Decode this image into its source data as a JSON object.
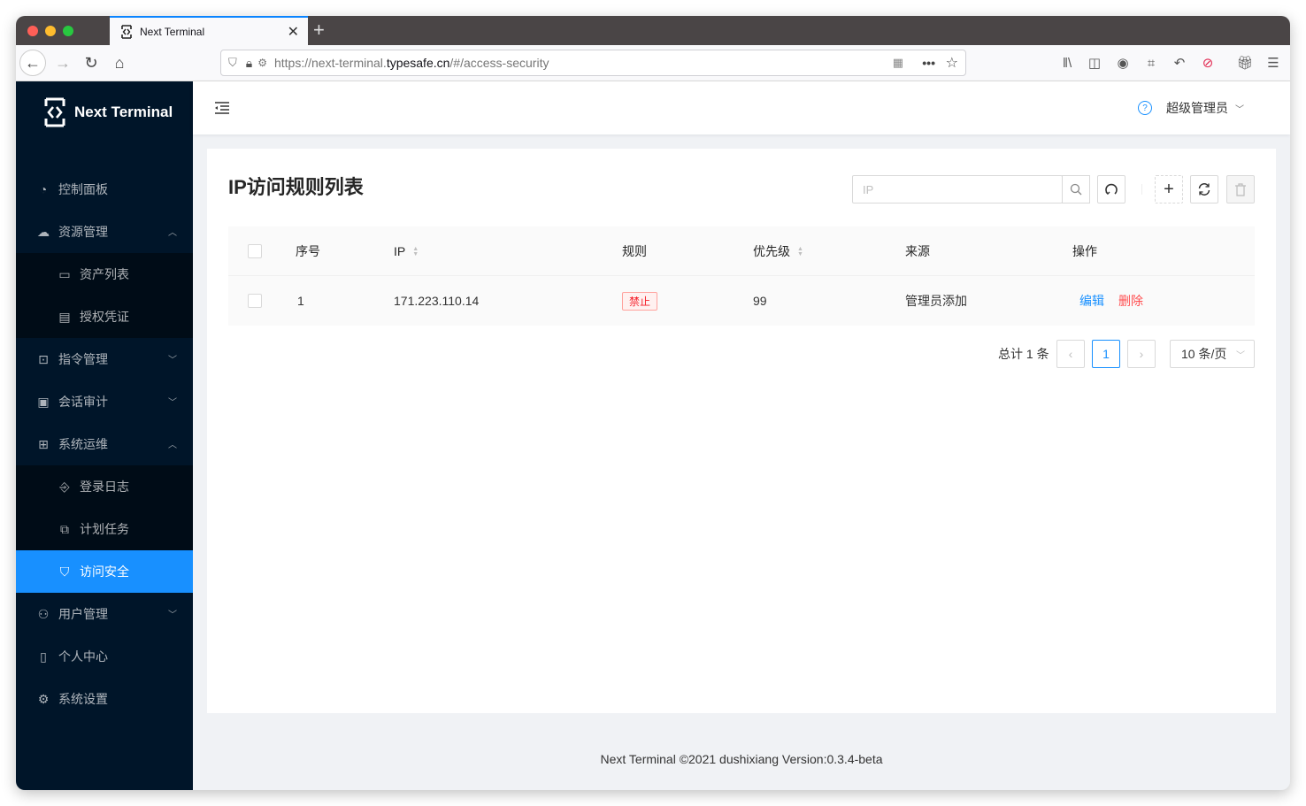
{
  "browser": {
    "tab_title": "Next Terminal",
    "url_prefix": "https://next-terminal.",
    "url_host": "typesafe.cn",
    "url_suffix": "/#/access-security"
  },
  "app": {
    "name": "Next Terminal",
    "accent": "#1890ff",
    "sidebar_bg": "#001529"
  },
  "sidebar": {
    "items": [
      {
        "label": "控制面板",
        "icon": "dashboard-icon"
      },
      {
        "label": "资源管理",
        "icon": "cloud-icon",
        "expanded": true
      },
      {
        "label": "资产列表",
        "icon": "desktop-icon",
        "sub": true
      },
      {
        "label": "授权凭证",
        "icon": "idcard-icon",
        "sub": true
      },
      {
        "label": "指令管理",
        "icon": "code-icon"
      },
      {
        "label": "会话审计",
        "icon": "audit-icon"
      },
      {
        "label": "系统运维",
        "icon": "control-icon",
        "expanded": true
      },
      {
        "label": "登录日志",
        "icon": "login-icon",
        "sub": true
      },
      {
        "label": "计划任务",
        "icon": "block-icon",
        "sub": true
      },
      {
        "label": "访问安全",
        "icon": "shield-icon",
        "sub": true,
        "active": true
      },
      {
        "label": "用户管理",
        "icon": "user-icon"
      },
      {
        "label": "个人中心",
        "icon": "profile-icon"
      },
      {
        "label": "系统设置",
        "icon": "setting-icon"
      }
    ]
  },
  "header": {
    "user": "超级管理员"
  },
  "page": {
    "title": "IP访问规则列表",
    "search_placeholder": "IP"
  },
  "table": {
    "columns": [
      "序号",
      "IP",
      "规则",
      "优先级",
      "来源",
      "操作"
    ],
    "rows": [
      {
        "index": "1",
        "ip": "171.223.110.14",
        "rule": "禁止",
        "priority": "99",
        "source": "管理员添加",
        "edit": "编辑",
        "delete": "删除"
      }
    ]
  },
  "pagination": {
    "total": "总计 1 条",
    "current": "1",
    "page_size": "10 条/页"
  },
  "footer": "Next Terminal ©2021 dushixiang Version:0.3.4-beta"
}
